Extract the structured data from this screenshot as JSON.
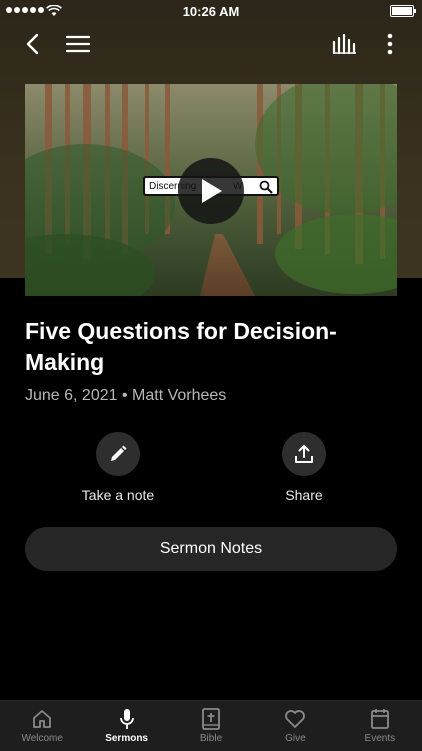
{
  "status_bar": {
    "time": "10:26 AM"
  },
  "video": {
    "search_text": "Discerning",
    "search_suffix": "W"
  },
  "sermon": {
    "title": "Five Questions for Decision-Making",
    "meta": "June 6, 2021 • Matt Vorhees"
  },
  "actions": {
    "note_label": "Take a note",
    "share_label": "Share"
  },
  "notes_button_label": "Sermon Notes",
  "tabs": [
    {
      "label": "Welcome",
      "icon": "home-icon",
      "active": false
    },
    {
      "label": "Sermons",
      "icon": "microphone-icon",
      "active": true
    },
    {
      "label": "Bible",
      "icon": "bible-icon",
      "active": false
    },
    {
      "label": "Give",
      "icon": "heart-icon",
      "active": false
    },
    {
      "label": "Events",
      "icon": "calendar-icon",
      "active": false
    }
  ]
}
